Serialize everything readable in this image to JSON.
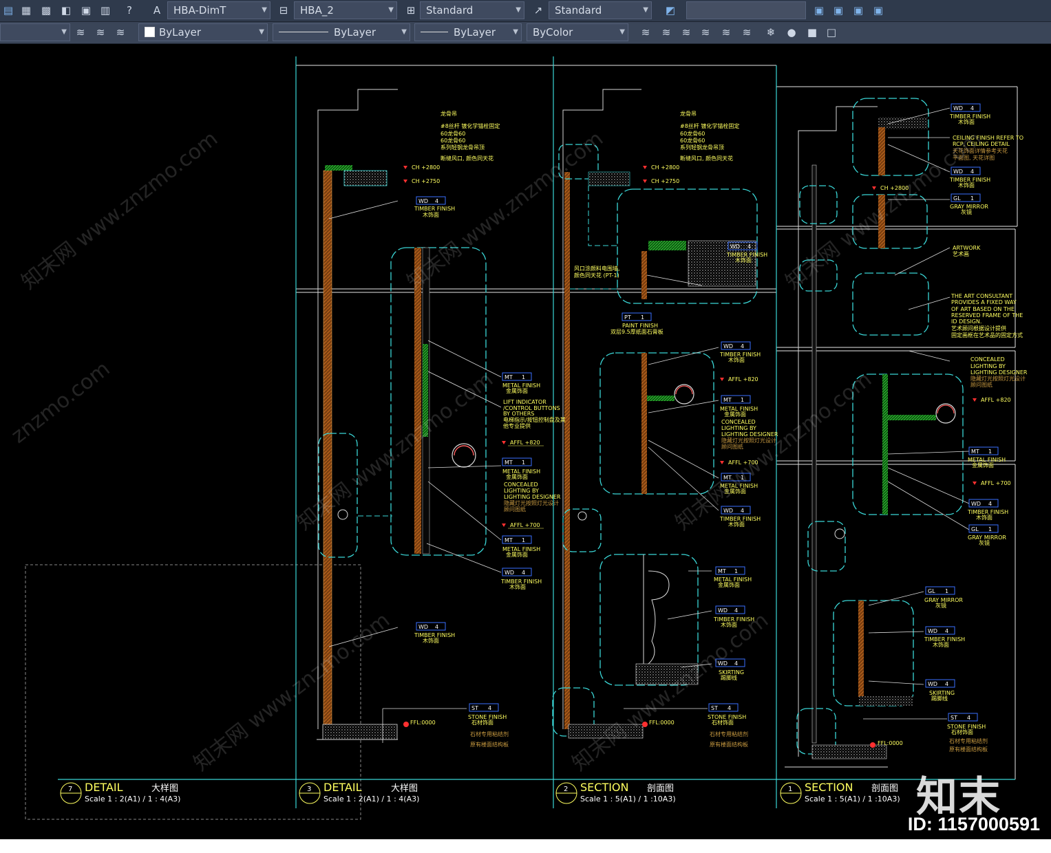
{
  "toolbar": {
    "dimstyle": "HBA-DimT",
    "tablestyle": "HBA_2",
    "textstyle": "Standard",
    "mleaderstyle": "Standard",
    "color": "ByLayer",
    "linetype": "ByLayer",
    "lineweight": "ByLayer",
    "plotstyle": "ByColor"
  },
  "drawing": {
    "views": [
      {
        "num": "7",
        "title": "DETAIL",
        "cn": "大样图",
        "scale": "Scale 1 : 2(A1) / 1 : 4(A3)"
      },
      {
        "num": "3",
        "title": "DETAIL",
        "cn": "大样图",
        "scale": "Scale 1 : 2(A1) / 1 : 4(A3)"
      },
      {
        "num": "2",
        "title": "SECTION",
        "cn": "剖面图",
        "scale": "Scale 1 : 5(A1) / 1 :10A3)"
      },
      {
        "num": "1",
        "title": "SECTION",
        "cn": "剖面图",
        "scale": "Scale 1 : 5(A1) / 1 :10A3)"
      }
    ],
    "levels": {
      "ch2800": "CH +2800",
      "ch2750": "CH +2750",
      "affl820": "AFFL +820",
      "affl700": "AFFL +700",
      "ffl": "FFL:0000"
    },
    "tags": {
      "wd": "WD",
      "mt": "MT",
      "st": "ST",
      "gl": "GL",
      "pt": "PT",
      "n4": "4",
      "n1": "1"
    },
    "labels": {
      "timber": "TIMBER FINISH",
      "timber_cn": "木饰面",
      "metal": "METAL FINISH",
      "metal_cn": "金属饰面",
      "stone": "STONE FINISH",
      "stone_cn": "石材饰面",
      "gray_mirror": "GRAY MIRROR",
      "gray_mirror_cn": "灰镜",
      "paint": "PAINT FINISH",
      "paint_cn": "双层9.5厚纸面石膏板",
      "skirting": "SKIRTING",
      "skirting_cn": "踢脚线",
      "concealed": "CONCEALED",
      "lighting_by": "LIGHTING BY",
      "lighting_designer": "LIGHTING DESIGNER",
      "lighting_cn": "隐藏灯光按照灯光设计",
      "lighting_cn2": "顾问图纸",
      "lift1": "LIFT INDICATOR",
      "lift2": "/CONTROL BUTTONS",
      "lift3": "BY OTHERS",
      "lift_cn1": "电梯指示/按钮控制盘及其",
      "lift_cn2": "他专业提供",
      "artwork": "ARTWORK",
      "artwork_cn": "艺术画",
      "art1": "THE ART CONSULTANT",
      "art2": "PROVIDES A FIXED WAY",
      "art3": "OF ART BASED ON THE",
      "art4": "RESERVED FRAME OF THE",
      "art5": "ID DESIGN.",
      "art_cn1": "艺术顾问根据设计提供",
      "art_cn2": "固定画框在艺术品的固定方式",
      "ceil1": "CEILING FINISH REFER TO",
      "ceil2": "RCP, CEILING DETAIL",
      "ceil_cn1": "天花饰面详情参考天花",
      "ceil_cn2": "平面图, 天花详图",
      "cn_a1": "龙骨吊",
      "cn_a2": "#8丝杆 镀化学锚栓固定",
      "cn_a3": "60龙骨60",
      "cn_a4": "60龙骨60",
      "cn_a5": "系列轻钢龙骨吊顶",
      "cn_a6": "断缝风口, 颜色同天花",
      "cn_b1": "风口涂颜料电围墙,",
      "cn_b2": "颜色同天花 (PT-1)",
      "stone_cn_a": "石材专用粘结剂",
      "stone_cn_b": "原有楼面结构板"
    }
  },
  "watermark": {
    "text": "知末网 www.znzmo.com",
    "text2": "znzmo.com"
  },
  "brand": {
    "logo": "知末",
    "id": "ID: 1157000591"
  }
}
